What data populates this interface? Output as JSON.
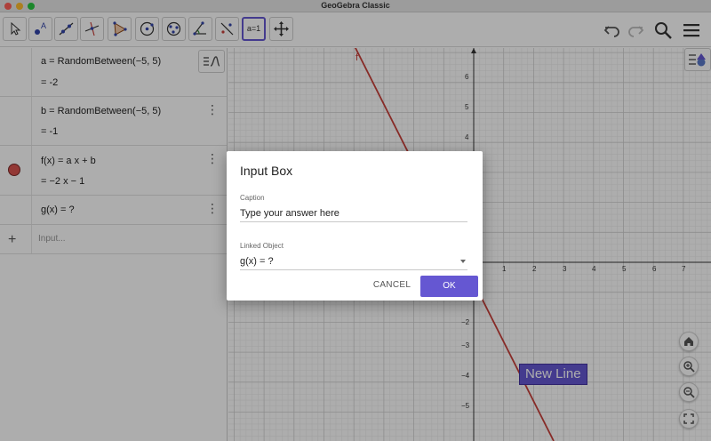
{
  "window": {
    "title": "GeoGebra Classic"
  },
  "toolbar": {
    "tools": [
      {
        "name": "move-tool-icon"
      },
      {
        "name": "point-tool-icon",
        "glyph": "A"
      },
      {
        "name": "line-tool-icon"
      },
      {
        "name": "perpendicular-line-tool-icon"
      },
      {
        "name": "polygon-tool-icon"
      },
      {
        "name": "circle-tool-icon"
      },
      {
        "name": "conic-tool-icon"
      },
      {
        "name": "angle-tool-icon"
      },
      {
        "name": "reflect-tool-icon"
      },
      {
        "name": "slider-tool-icon",
        "glyph": "a=1"
      },
      {
        "name": "move-graphics-tool-icon"
      }
    ],
    "right": [
      "undo-icon",
      "redo-icon",
      "search-icon",
      "menu-icon"
    ]
  },
  "algebra": {
    "rows": [
      {
        "definition": "a  =  RandomBetween(−5, 5)",
        "value": "=  -2"
      },
      {
        "definition": "b  =  RandomBetween(−5, 5)",
        "value": "=  -1"
      },
      {
        "definition": "f(x)  =  a x + b",
        "value": "=   −2 x − 1"
      },
      {
        "definition": "g(x)  =  ?"
      }
    ],
    "input_placeholder": "Input..."
  },
  "graphics": {
    "function_label": "f",
    "x_ticks": [
      "1",
      "2",
      "3",
      "4",
      "5",
      "6",
      "7"
    ],
    "y_ticks_pos": [
      "6",
      "5",
      "4"
    ],
    "y_ticks_neg": [
      "−2",
      "−3",
      "−4",
      "−5"
    ],
    "new_line_label": "New Line",
    "line_color": "#c8403a",
    "accent_color": "#6557d2"
  },
  "dialog": {
    "title": "Input Box",
    "caption_label": "Caption",
    "caption_value": "Type your answer here",
    "linked_label": "Linked Object",
    "linked_value": "g(x) = ?",
    "cancel_label": "CANCEL",
    "ok_label": "OK"
  }
}
